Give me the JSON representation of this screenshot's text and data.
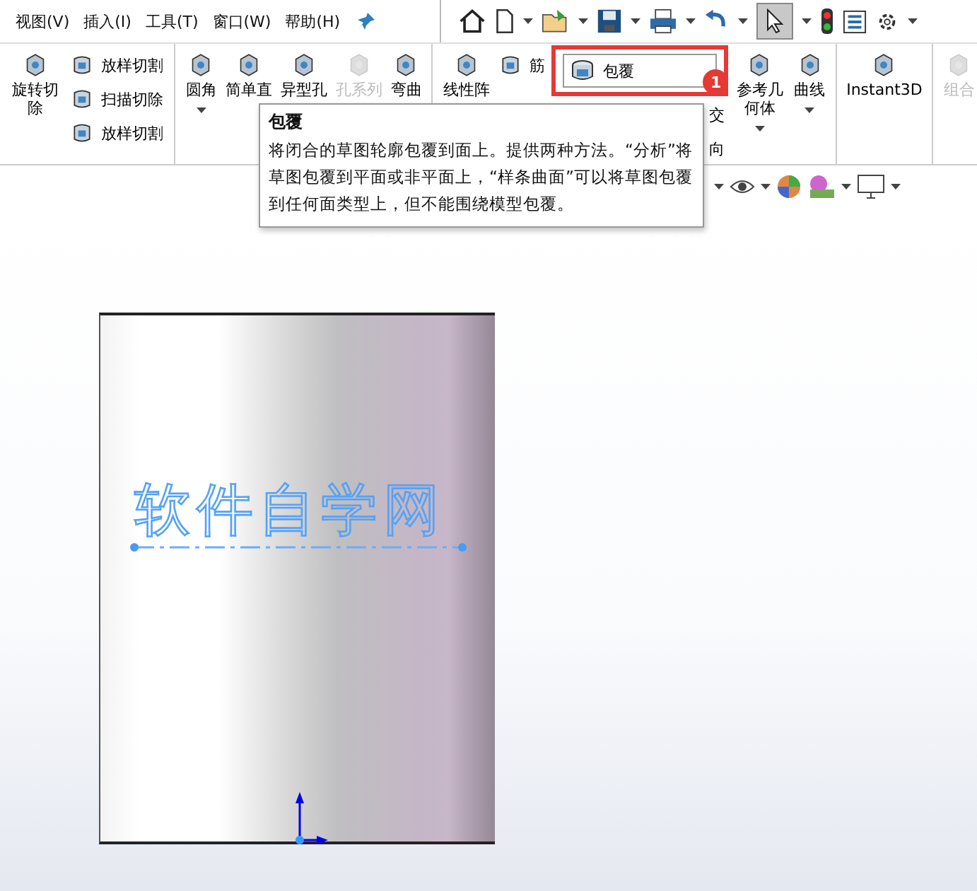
{
  "menu": [
    {
      "label": "视图(V)"
    },
    {
      "label": "插入(I)"
    },
    {
      "label": "工具(T)"
    },
    {
      "label": "窗口(W)"
    },
    {
      "label": "帮助(H)"
    }
  ],
  "ribbon": {
    "groups": [
      {
        "items": [
          {
            "kind": "large",
            "label": "旋转切除",
            "disabled": false,
            "dropdown": false
          },
          {
            "kind": "stack",
            "items": [
              {
                "label": "放样切割",
                "highlighted": false
              },
              {
                "label": "扫描切除",
                "highlighted": false
              },
              {
                "label": "放样切割",
                "highlighted": false
              }
            ]
          }
        ]
      },
      {
        "items": [
          {
            "kind": "large",
            "label": "圆角",
            "disabled": false,
            "dropdown": true
          },
          {
            "kind": "large",
            "label": "简单直",
            "disabled": false,
            "dropdown": false
          },
          {
            "kind": "large",
            "label": "异型孔",
            "disabled": false,
            "dropdown": false
          },
          {
            "kind": "large",
            "label": "孔系列",
            "disabled": true,
            "dropdown": false
          },
          {
            "kind": "large",
            "label": "弯曲",
            "disabled": false,
            "dropdown": false
          }
        ]
      },
      {
        "items": [
          {
            "kind": "large",
            "label": "线性阵",
            "disabled": false,
            "dropdown": false
          },
          {
            "kind": "stack",
            "items": [
              {
                "label": "筋",
                "highlighted": false
              }
            ]
          },
          {
            "kind": "stack",
            "items": [
              {
                "label": "包覆",
                "highlighted": true
              },
              {
                "label": "交",
                "highlighted": false
              },
              {
                "label": "向",
                "highlighted": false
              }
            ]
          },
          {
            "kind": "large",
            "label": "参考几何体",
            "disabled": false,
            "dropdown": true
          },
          {
            "kind": "large",
            "label": "曲线",
            "disabled": false,
            "dropdown": true
          }
        ]
      },
      {
        "items": [
          {
            "kind": "large",
            "label": "Instant3D",
            "disabled": false,
            "dropdown": false
          }
        ]
      },
      {
        "items": [
          {
            "kind": "large",
            "label": "组合",
            "disabled": true,
            "dropdown": false
          }
        ]
      }
    ]
  },
  "callout": {
    "label": "1"
  },
  "tooltip": {
    "title": "包覆",
    "text": "将闭合的草图轮廓包覆到面上。提供两种方法。“分析”将草图包覆到平面或非平面上，“样条曲面”可以将草图包覆到任何面类型上，但不能围绕模型包覆。"
  },
  "sketch": {
    "text": "软件自学网"
  }
}
